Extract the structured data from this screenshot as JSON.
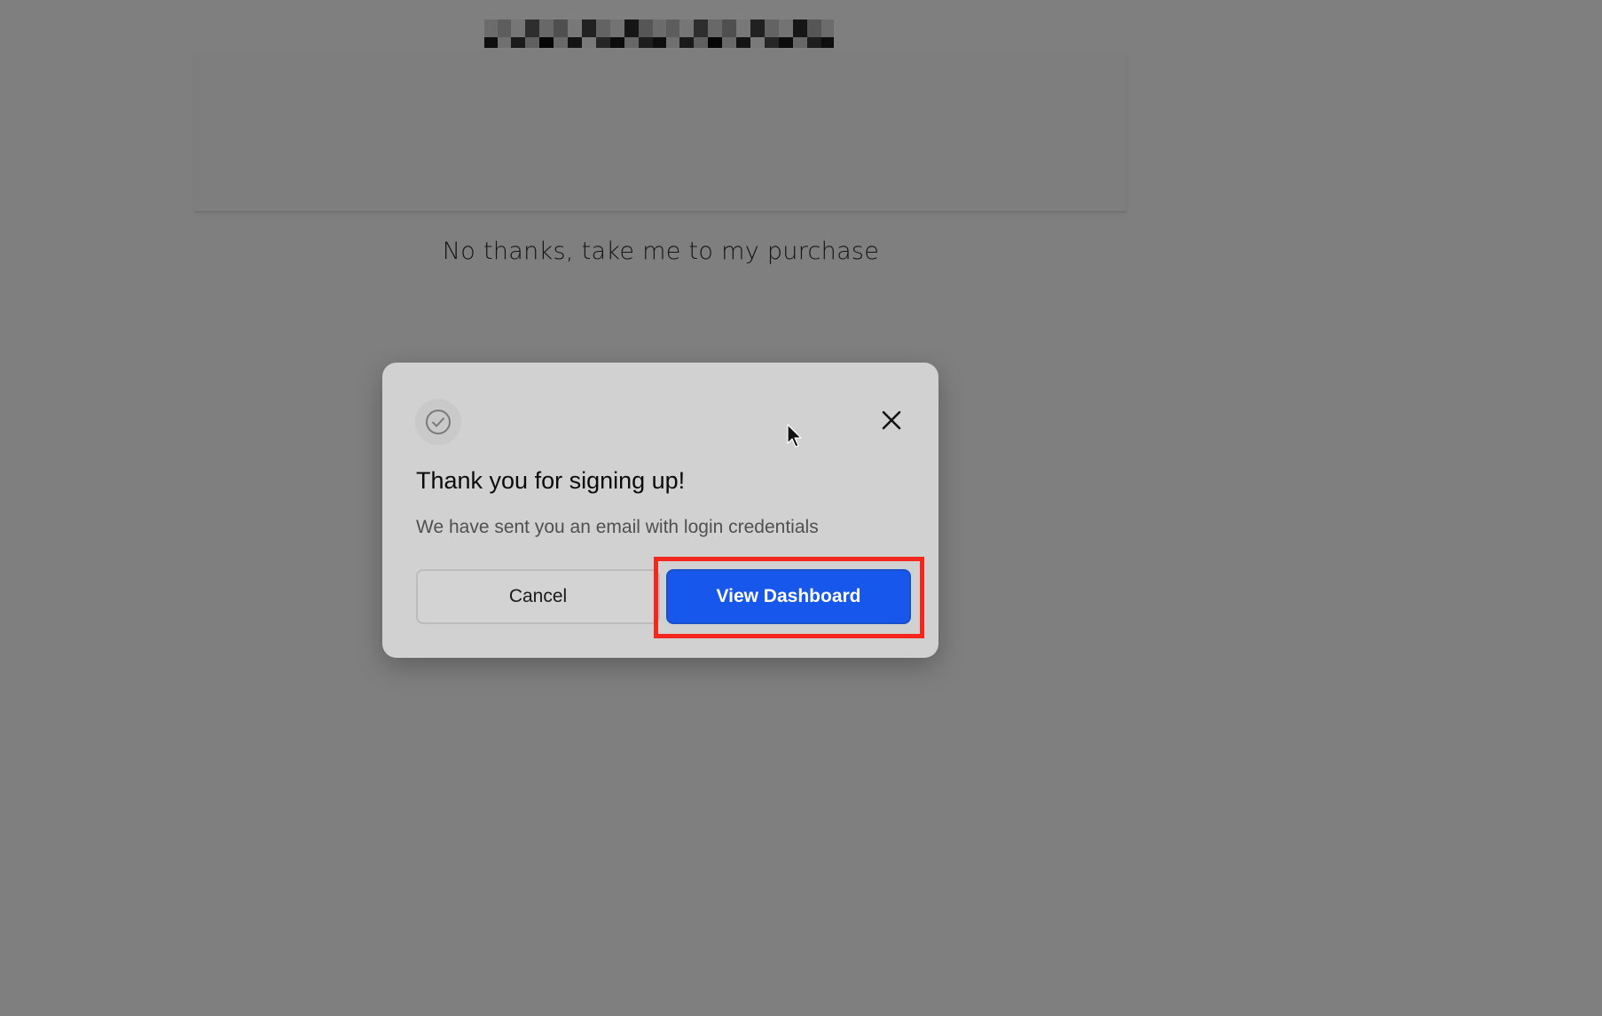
{
  "background": {
    "no_thanks_link": "No thanks, take me to my purchase"
  },
  "modal": {
    "icon": "check-circle-icon",
    "close_icon": "close-icon",
    "title": "Thank you for signing up!",
    "message": "We have sent you an email with login credentials",
    "cancel_label": "Cancel",
    "primary_label": "View Dashboard"
  },
  "colors": {
    "primary_button": "#1757ec",
    "highlight": "#f3271c",
    "overlay": "rgba(0,0,0,0.5)"
  }
}
